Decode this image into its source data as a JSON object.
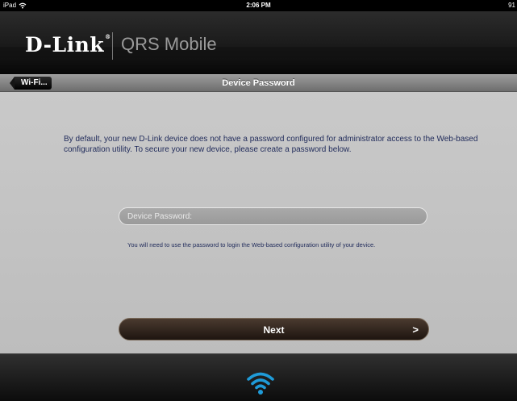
{
  "status_bar": {
    "device": "iPad",
    "time": "2:06 PM",
    "battery": "91"
  },
  "header": {
    "brand": "D-Link",
    "brand_mark": "®",
    "product": "QRS Mobile"
  },
  "nav": {
    "back_label": "Wi-Fi...",
    "title": "Device Password"
  },
  "content": {
    "intro": "By default, your new D-Link device does not have a password configured for administrator access to the Web-based configuration utility. To secure your new device, please create a password below.",
    "password_placeholder": "Device Password:",
    "hint": "You will need to use the password to login the Web-based configuration utility of your device.",
    "next_label": "Next",
    "next_arrow": ">"
  },
  "footer": {
    "icon": "wifi-icon"
  },
  "colors": {
    "accent_blue": "#1f9bd8",
    "text_navy": "#1f2a5a",
    "button_brown": "#2e2219"
  }
}
